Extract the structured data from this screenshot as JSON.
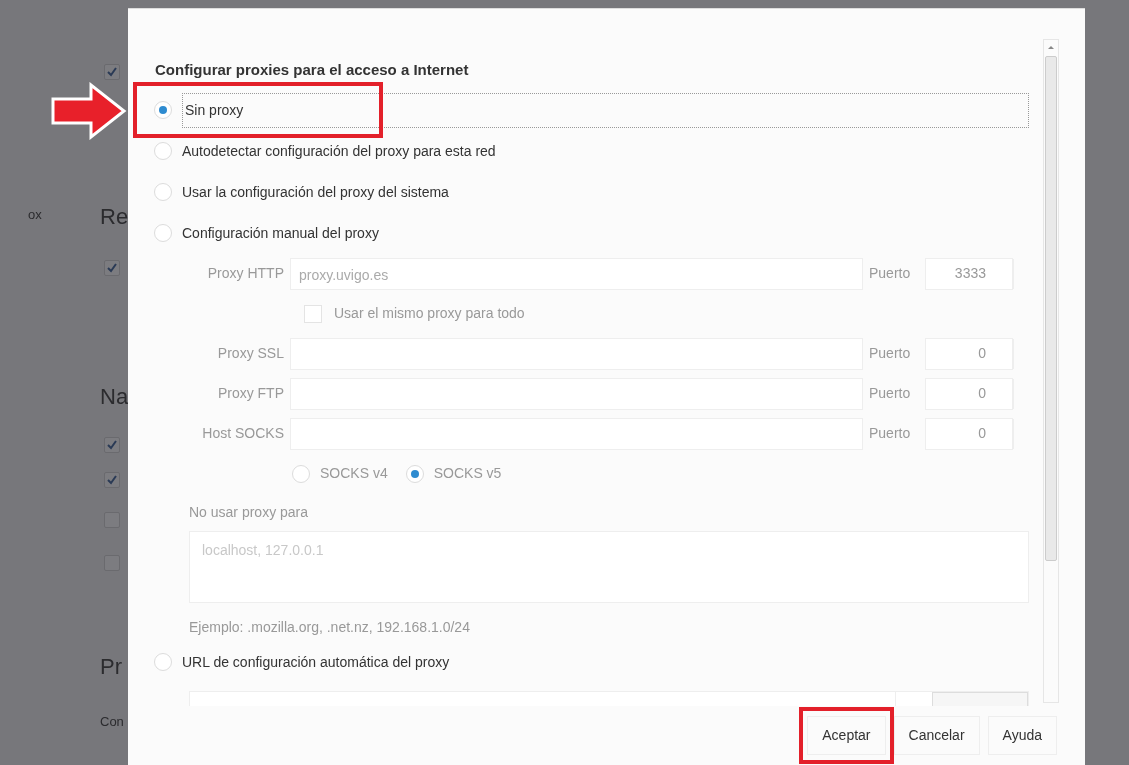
{
  "background": [
    {
      "kind": "checkbox",
      "checked": true
    },
    {
      "kind": "text",
      "text": "ox"
    },
    {
      "kind": "heading",
      "text": "Re"
    },
    {
      "kind": "checkbox",
      "checked": true
    },
    {
      "kind": "heading",
      "text": "Na"
    },
    {
      "kind": "checkbox",
      "checked": true
    },
    {
      "kind": "checkbox",
      "checked": true
    },
    {
      "kind": "checkbox",
      "checked": false
    },
    {
      "kind": "checkbox",
      "checked": false
    },
    {
      "kind": "heading",
      "text": "Pr"
    },
    {
      "kind": "text",
      "text": "Con"
    }
  ],
  "dialog": {
    "title": "Configurar proxies para el acceso a Internet",
    "modes": [
      {
        "label": "Sin proxy",
        "selected": true
      },
      {
        "label": "Autodetectar configuración del proxy para esta red",
        "selected": false
      },
      {
        "label": "Usar la configuración del proxy del sistema",
        "selected": false
      },
      {
        "label": "Configuración manual del proxy",
        "selected": false
      }
    ],
    "manual": {
      "disabled": true,
      "rows": [
        {
          "label": "Proxy HTTP",
          "value": "proxy.uvigo.es",
          "port_label": "Puerto",
          "port": "3333"
        },
        {
          "label": "Proxy SSL",
          "port_label": "Puerto",
          "port": "0"
        },
        {
          "label": "Proxy FTP",
          "port_label": "Puerto",
          "port": "0"
        },
        {
          "label": "Host SOCKS",
          "port_label": "Puerto",
          "port": "0"
        }
      ],
      "same_proxy": {
        "label": "Usar el mismo proxy para todo",
        "checked": false
      },
      "socks_versions": [
        {
          "label": "SOCKS v4",
          "selected": false
        },
        {
          "label": "SOCKS v5",
          "selected": true
        }
      ],
      "no_proxy_label": "No usar proxy para",
      "no_proxy_value": "localhost, 127.0.0.1",
      "example": "Ejemplo: .mozilla.org, .net.nz, 192.168.1.0/24"
    },
    "pac": {
      "label": "URL de configuración automática del proxy",
      "selected": false
    },
    "buttons": [
      {
        "label": "Aceptar"
      },
      {
        "label": "Cancelar"
      },
      {
        "label": "Ayuda"
      }
    ]
  }
}
